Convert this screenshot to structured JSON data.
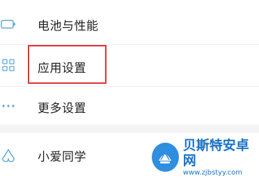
{
  "settings": {
    "items": [
      {
        "label": "电池与性能",
        "icon": "battery-icon"
      },
      {
        "label": "应用设置",
        "icon": "grid-apps-icon"
      },
      {
        "label": "更多设置",
        "icon": "more-dots-icon"
      },
      {
        "label": "小爱同学",
        "icon": "xiaoai-icon"
      }
    ]
  },
  "highlight": {
    "color": "#e03030",
    "target": "应用设置"
  },
  "watermark": {
    "title": "贝斯特安卓网",
    "url": "www.zjbstyy.com",
    "brand_color": "#1a73c9"
  },
  "colors": {
    "icon": "#5ba4d6",
    "divider": "#ececec",
    "section_gap": "#f4f4f4"
  }
}
